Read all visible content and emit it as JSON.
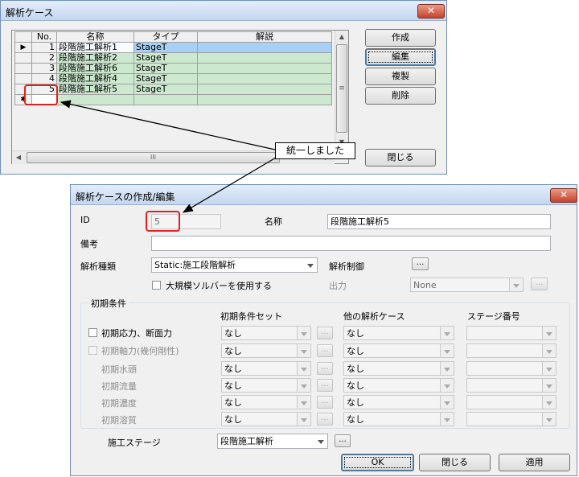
{
  "top_dialog": {
    "title": "解析ケース",
    "close_glyph": "✕",
    "columns": [
      "No.",
      "名称",
      "タイプ",
      "解説"
    ],
    "rows": [
      {
        "no": "1",
        "name": "段階施工解析1",
        "type": "StageT",
        "desc": ""
      },
      {
        "no": "2",
        "name": "段階施工解析2",
        "type": "StageT",
        "desc": ""
      },
      {
        "no": "3",
        "name": "段階施工解析6",
        "type": "StageT",
        "desc": ""
      },
      {
        "no": "4",
        "name": "段階施工解析4",
        "type": "StageT",
        "desc": ""
      },
      {
        "no": "5",
        "name": "段階施工解析5",
        "type": "StageT",
        "desc": ""
      }
    ],
    "current_row_marker": "▶",
    "new_row_marker": "✱",
    "buttons": {
      "create": "作成",
      "edit": "編集",
      "duplicate": "複製",
      "delete": "削除",
      "close": "閉じる"
    },
    "hscroll_thumb_glyph": "III",
    "vscroll_thumb_glyph": "≡"
  },
  "callout": {
    "text": "統一しました"
  },
  "edit_dialog": {
    "title": "解析ケースの作成/編集",
    "close_glyph": "✕",
    "id_label": "ID",
    "id_value": "5",
    "name_label": "名称",
    "name_value": "段階施工解析5",
    "note_label": "備考",
    "note_value": "",
    "analysis_type_label": "解析種類",
    "analysis_type_value": "Static:施工段階解析",
    "analysis_control_label": "解析制御",
    "ellipsis": "...",
    "large_solver_label": "大規模ソルバーを使用する",
    "output_label": "出力",
    "output_value": "None",
    "initial_conditions": {
      "group_label": "初期条件",
      "col_set": "初期条件セット",
      "col_other": "他の解析ケース",
      "col_stage": "ステージ番号",
      "rows": [
        {
          "label": "初期応力、断面力",
          "set": "なし",
          "other": "なし",
          "stage": ""
        },
        {
          "label": "初期軸力(幾何剛性)",
          "set": "なし",
          "other": "なし",
          "stage": ""
        },
        {
          "label": "初期水頭",
          "set": "なし",
          "other": "なし",
          "stage": ""
        },
        {
          "label": "初期流量",
          "set": "なし",
          "other": "なし",
          "stage": ""
        },
        {
          "label": "初期濃度",
          "set": "なし",
          "other": "なし",
          "stage": ""
        },
        {
          "label": "初期溶質",
          "set": "なし",
          "other": "なし",
          "stage": ""
        }
      ]
    },
    "construction_stage_label": "施工ステージ",
    "construction_stage_value": "段階施工解析",
    "buttons": {
      "ok": "OK",
      "close": "閉じる",
      "apply": "適用"
    }
  }
}
